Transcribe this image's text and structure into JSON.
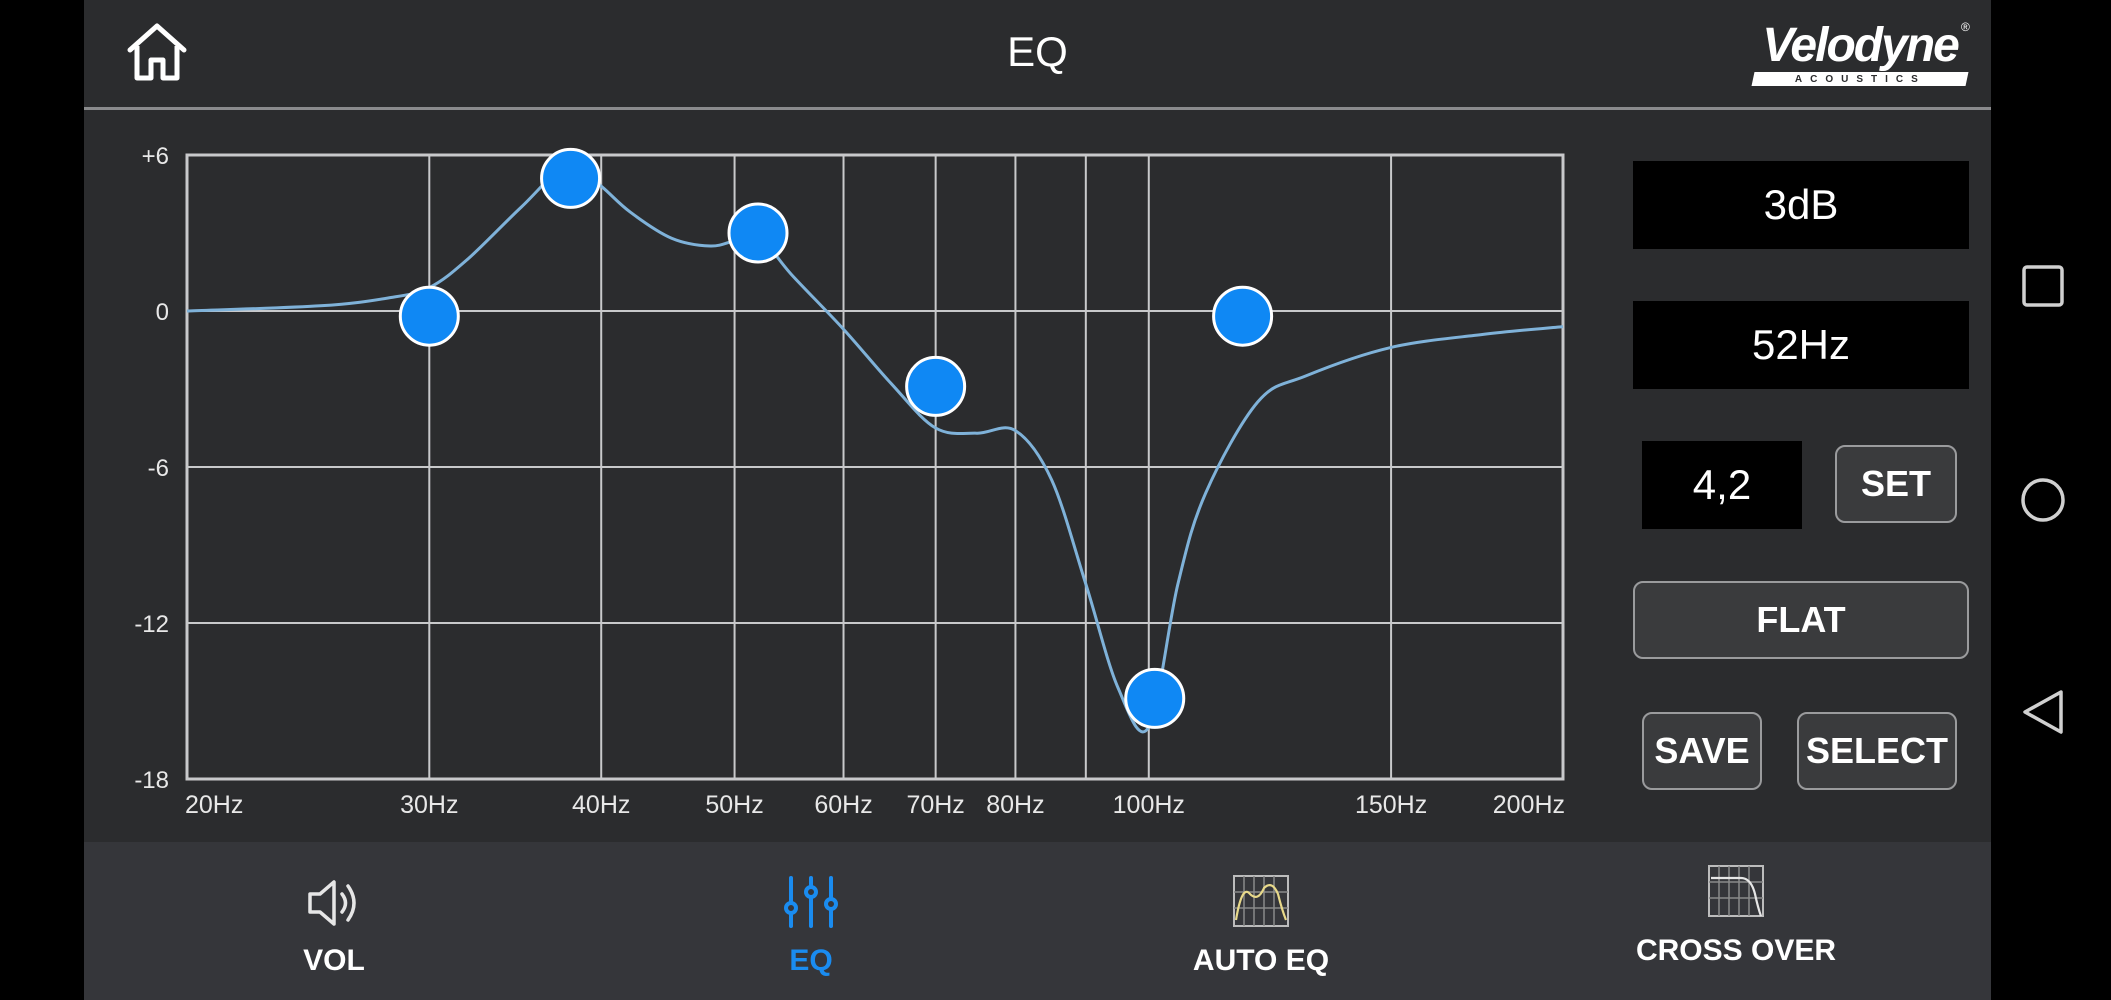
{
  "header": {
    "title": "EQ",
    "brand": "Velodyne",
    "brand_sub": "ACOUSTICS"
  },
  "chart_data": {
    "type": "line",
    "x_scale": "log",
    "xlim": [
      20,
      200
    ],
    "ylim": [
      -18,
      6
    ],
    "y_ticks": [
      6,
      0,
      -6,
      -12,
      -18
    ],
    "y_tick_labels": [
      "+6",
      "0",
      "-6",
      "-12",
      "-18"
    ],
    "x_ticks": [
      20,
      30,
      40,
      50,
      60,
      70,
      80,
      90,
      100,
      150,
      200
    ],
    "x_tick_labels": [
      "20Hz",
      "30Hz",
      "40Hz",
      "50Hz",
      "60Hz",
      "70Hz",
      "80Hz",
      "",
      "100Hz",
      "150Hz",
      "200Hz"
    ],
    "grid": true,
    "curve": {
      "x": [
        20,
        25,
        28,
        30,
        32,
        35,
        38,
        40,
        42,
        45,
        48,
        50,
        52,
        55,
        60,
        65,
        70,
        75,
        80,
        85,
        90,
        95,
        100,
        105,
        110,
        120,
        130,
        150,
        175,
        200
      ],
      "y": [
        0,
        0.2,
        0.5,
        0.9,
        2.0,
        4.0,
        5.7,
        4.8,
        3.8,
        2.8,
        2.5,
        2.7,
        2.9,
        1.4,
        -0.7,
        -2.8,
        -4.5,
        -4.7,
        -4.6,
        -6.5,
        -10.5,
        -14.5,
        -16.0,
        -10.5,
        -7.0,
        -3.5,
        -2.5,
        -1.4,
        -0.9,
        -0.6
      ]
    },
    "points": [
      {
        "x": 30,
        "y": -0.2
      },
      {
        "x": 38,
        "y": 5.1
      },
      {
        "x": 52,
        "y": 3.0
      },
      {
        "x": 70,
        "y": -2.9
      },
      {
        "x": 101,
        "y": -14.9
      },
      {
        "x": 117,
        "y": -0.2
      }
    ],
    "colors": {
      "curve": "#7fb2d9",
      "point": "#0f88f4",
      "grid": "#c8c9cb"
    }
  },
  "panel": {
    "gain": "3dB",
    "frequency": "52Hz",
    "q_value": "4,2",
    "set_label": "SET",
    "flat_label": "FLAT",
    "save_label": "SAVE",
    "select_label": "SELECT"
  },
  "nav": {
    "vol": "VOL",
    "eq": "EQ",
    "auto_eq": "AUTO EQ",
    "cross_over": "CROSS OVER"
  },
  "colors": {
    "accent": "#1a8cf0",
    "background": "#2b2c2e",
    "nav_bg": "#35363a"
  }
}
